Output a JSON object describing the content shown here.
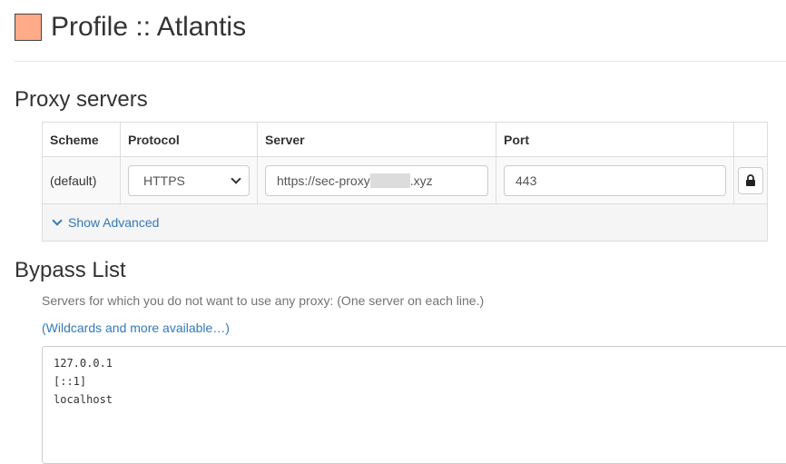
{
  "header": {
    "title": "Profile :: Atlantis",
    "swatch_color": "#ffaa88"
  },
  "proxy": {
    "title": "Proxy servers",
    "columns": [
      "Scheme",
      "Protocol",
      "Server",
      "Port",
      ""
    ],
    "row": {
      "scheme": "(default)",
      "protocol": "HTTPS",
      "server_prefix": "https://sec-proxy",
      "server_suffix": ".xyz",
      "port": "443"
    },
    "advanced_label": "Show Advanced"
  },
  "bypass": {
    "title": "Bypass List",
    "help": "Servers for which you do not want to use any proxy: (One server on each line.)",
    "link": "(Wildcards and more available…)",
    "entries": [
      "127.0.0.1",
      "[::1]",
      "localhost"
    ]
  },
  "colors": {
    "link": "#337ab7",
    "border": "#dddddd"
  }
}
